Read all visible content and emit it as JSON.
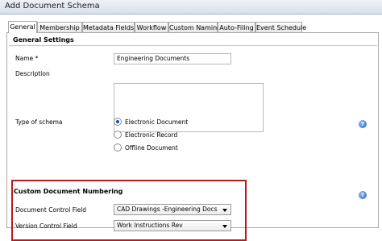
{
  "window": {
    "title": "Add Document Schema"
  },
  "tabs": [
    {
      "label": "General"
    },
    {
      "label": "Membership"
    },
    {
      "label": "Metadata Fields"
    },
    {
      "label": "Workflow"
    },
    {
      "label": "Custom Naming"
    },
    {
      "label": "Auto-Filing"
    },
    {
      "label": "Event Schedule"
    }
  ],
  "general": {
    "header": "General Settings",
    "name_label": "Name *",
    "name_value": "Engineering Documents",
    "description_label": "Description",
    "schema_type_label": "Type of schema",
    "schema_options": [
      {
        "label": "Electronic Document",
        "selected": true
      },
      {
        "label": "Electronic Record",
        "selected": false
      },
      {
        "label": "Offline Document",
        "selected": false
      }
    ]
  },
  "numbering": {
    "header": "Custom Document Numbering",
    "doc_control_label": "Document Control Field",
    "doc_control_value": "CAD Drawings -Engineering Docs",
    "version_control_label": "Version Control Field",
    "version_control_value": "Work Instructions Rev"
  },
  "help_icon": "?"
}
